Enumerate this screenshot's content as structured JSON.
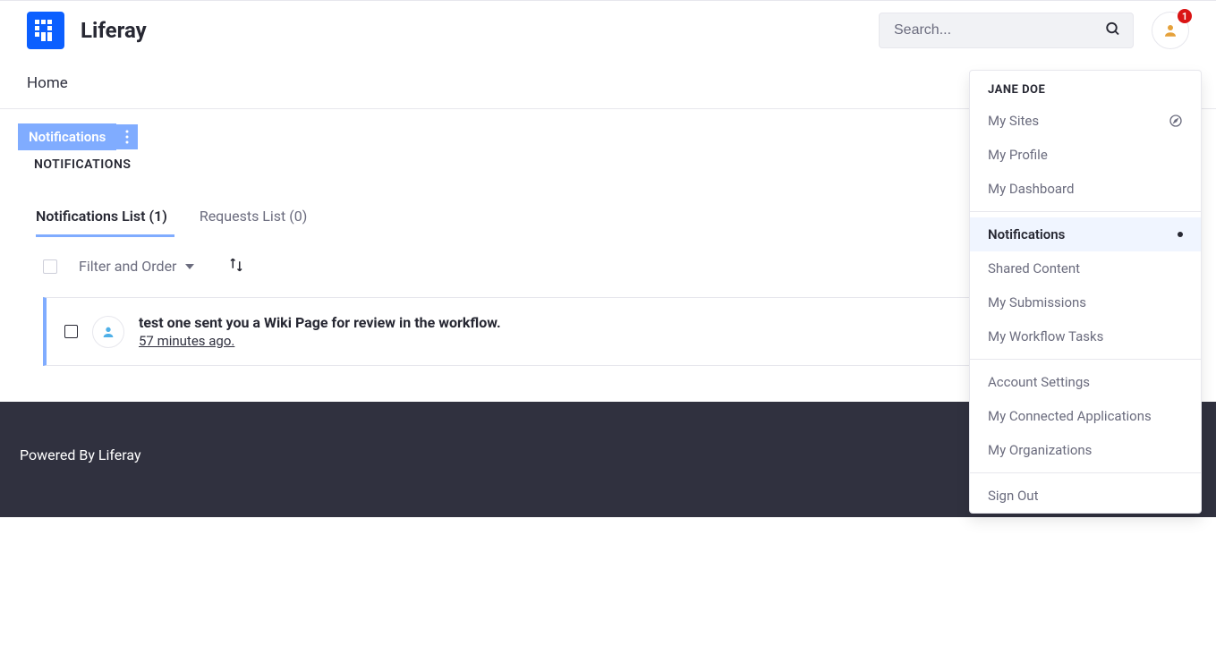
{
  "brand": "Liferay",
  "search": {
    "placeholder": "Search..."
  },
  "badge_count": "1",
  "nav": {
    "home": "Home"
  },
  "pill": {
    "label": "Notifications"
  },
  "breadcrumb": "NOTIFICATIONS",
  "tabs": {
    "notifications": "Notifications List (1)",
    "requests": "Requests List (0)"
  },
  "toolbar": {
    "filter": "Filter and Order"
  },
  "item": {
    "title": "test one sent you a Wiki Page for review in the workflow.",
    "time": "57 minutes ago."
  },
  "footer": "Powered By Liferay",
  "user_menu": {
    "name": "JANE DOE",
    "my_sites": "My Sites",
    "my_profile": "My Profile",
    "my_dashboard": "My Dashboard",
    "notifications": "Notifications",
    "shared_content": "Shared Content",
    "my_submissions": "My Submissions",
    "my_workflow": "My Workflow Tasks",
    "account_settings": "Account Settings",
    "connected_apps": "My Connected Applications",
    "my_orgs": "My Organizations",
    "sign_out": "Sign Out"
  }
}
